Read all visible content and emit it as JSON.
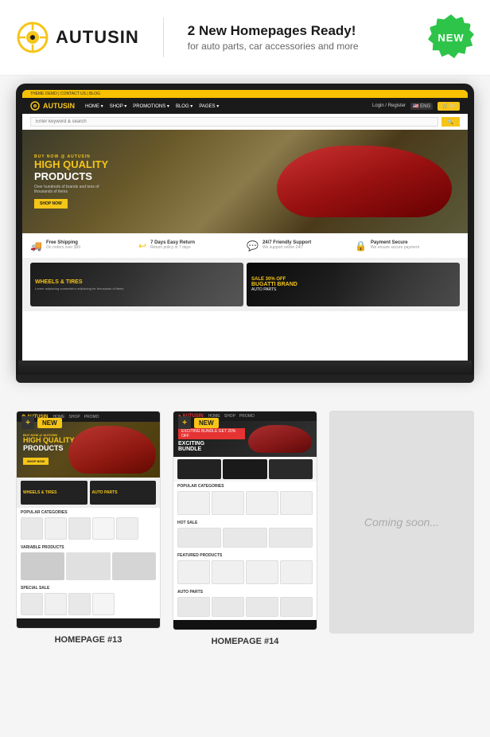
{
  "header": {
    "logo_text": "AUTUSIN",
    "tagline_main": "2 New Homepages Ready!",
    "tagline_sub": "for auto parts, car accessories and more",
    "new_badge": "NEW"
  },
  "site_preview": {
    "topbar": "THEME DEMO | CONTACT US | BLOG",
    "nav_logo": "AUTUSIN",
    "nav_links": [
      "HOME",
      "SHOP",
      "PROMOTIONS",
      "BLOG",
      "PAGES"
    ],
    "nav_right": [
      "Login / Register",
      "ENG",
      "Cart"
    ],
    "search_placeholder": "Enter keyword & search",
    "hero": {
      "sub": "BUY NOW @ AUTUSIN",
      "title_yellow": "HIGH QUALITY",
      "title_white": "PRODUCTS",
      "desc": "Over hundreds of brands and tens of thousands of items",
      "btn": "SHOP NOW"
    },
    "features": [
      {
        "icon": "🚚",
        "title": "Free Shipping",
        "desc": "On orders over $99"
      },
      {
        "icon": "↩",
        "title": "7 Days Easy Return",
        "desc": "Return policy in 7 days"
      },
      {
        "icon": "💬",
        "title": "24/7 Friendly Support",
        "desc": "We support online 24 hours a day"
      },
      {
        "icon": "🔒",
        "title": "Payment Secure",
        "desc": "We ensure secure payment"
      }
    ],
    "promo1": {
      "title": "WHEELS & TIRES",
      "desc": "Lorem adipiscing consectetur adipiscing for thousands of items"
    },
    "promo2": {
      "sale": "SALE 30% OFF",
      "title": "BUGATTI BRAND",
      "sub": "AUTO PARTS"
    }
  },
  "homepages": [
    {
      "number": "13",
      "label": "HOMEPAGE #13",
      "badge": "NEW",
      "hero": {
        "sub": "BUY NOW @ AUTUSIN",
        "title": "HIGH QUALITY",
        "subtitle": "PRODUCTS"
      },
      "banner1": "WHEELS & TIRES",
      "banner2": "AUTO PARTS",
      "section1": "POPULAR CATEGORIES",
      "section2": "VARIABLE PRODUCTS",
      "section3": "SPECIAL SALE"
    },
    {
      "number": "14",
      "label": "HOMEPAGE #14",
      "badge": "NEW",
      "hero_badge": "EXCITING BUNDLE GET 20% OFF",
      "hero_title": "EXCITING BUNDLE",
      "section1": "POPULAR CATEGORIES",
      "section2": "HOT SALE",
      "section3": "FEATURED PRODUCTS",
      "section4": "AUTO PARTS"
    },
    {
      "number": "soon",
      "label": "Coming soon...",
      "is_coming_soon": true
    }
  ],
  "icons": {
    "wheel": "⚙",
    "search": "🔍",
    "cart": "🛒",
    "plus": "+",
    "truck": "🚚",
    "return": "↩",
    "support": "💬",
    "lock": "🔒"
  }
}
